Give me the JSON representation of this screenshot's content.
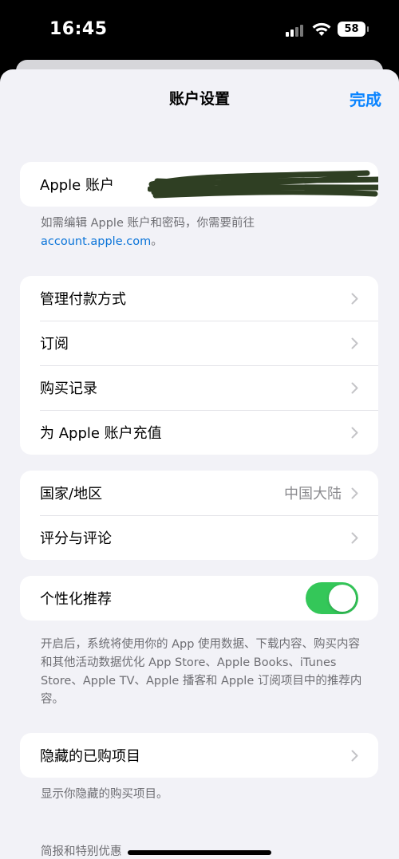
{
  "status": {
    "time": "16:45",
    "battery": "58"
  },
  "nav": {
    "title": "账户设置",
    "done": "完成"
  },
  "account": {
    "label": "Apple 账户",
    "note_prefix": "如需编辑 Apple 账户和密码，你需要前往",
    "note_link": "account.apple.com",
    "note_suffix": "。"
  },
  "group1": [
    {
      "label": "管理付款方式"
    },
    {
      "label": "订阅"
    },
    {
      "label": "购买记录"
    },
    {
      "label": "为 Apple 账户充值"
    }
  ],
  "group2": [
    {
      "label": "国家/地区",
      "value": "中国大陆"
    },
    {
      "label": "评分与评论"
    }
  ],
  "personalized": {
    "label": "个性化推荐",
    "enabled": true,
    "note": "开启后，系统将使用你的 App 使用数据、下载内容、购买内容和其他活动数据优化 App Store、Apple Books、iTunes Store、Apple TV、Apple 播客和 Apple 订阅项目中的推荐内容。"
  },
  "hidden": {
    "label": "隐藏的已购项目",
    "note": "显示你隐藏的购买项目。"
  },
  "footer_section": "简报和特别优惠",
  "colors": {
    "accent": "#0a84ff",
    "toggle_on": "#34c759",
    "background": "#f2f2f7"
  }
}
